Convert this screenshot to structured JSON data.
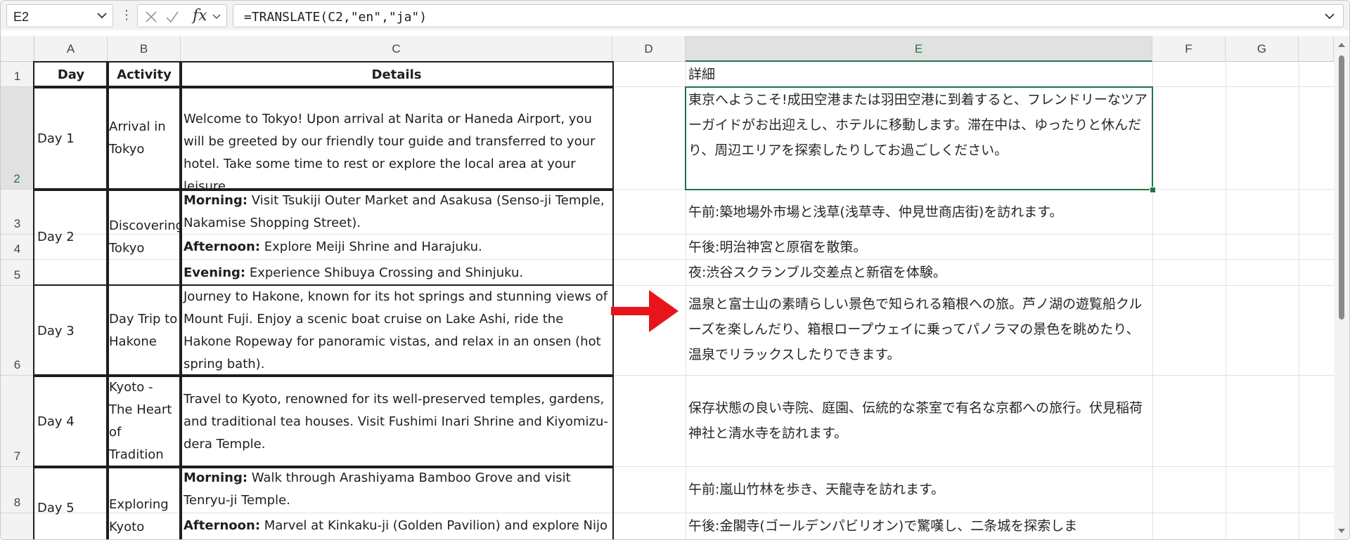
{
  "name_box": {
    "value": "E2"
  },
  "formula_bar": {
    "fx_label": "fx",
    "formula": "=TRANSLATE(C2,\"en\",\"ja\")"
  },
  "columns": [
    "A",
    "B",
    "C",
    "D",
    "E",
    "F",
    "G"
  ],
  "rows": [
    "1",
    "2",
    "3",
    "4",
    "5",
    "6",
    "7",
    "8"
  ],
  "table": {
    "headers": {
      "day": "Day",
      "activity": "Activity",
      "details": "Details"
    },
    "day1": {
      "day": "Day 1",
      "activity": "Arrival in Tokyo",
      "details": "Welcome to Tokyo! Upon arrival at Narita or Haneda Airport, you will be greeted by our friendly tour guide and transferred to your hotel. Take some time to rest or explore the local area at your leisure."
    },
    "day2": {
      "day": "Day 2",
      "activity": "Discovering Tokyo",
      "morning_label": "Morning:",
      "morning": " Visit Tsukiji Outer Market and Asakusa (Senso-ji Temple, Nakamise Shopping Street).",
      "afternoon_label": "Afternoon:",
      "afternoon": " Explore Meiji Shrine and Harajuku.",
      "evening_label": "Evening:",
      "evening": " Experience Shibuya Crossing and Shinjuku."
    },
    "day3": {
      "day": "Day 3",
      "activity": "Day Trip to Hakone",
      "details": "Journey to Hakone, known for its hot springs and stunning views of Mount Fuji. Enjoy a scenic boat cruise on Lake Ashi, ride the Hakone Ropeway for panoramic vistas, and relax in an onsen (hot spring bath)."
    },
    "day4": {
      "day": "Day 4",
      "activity": "Kyoto - The Heart of Tradition",
      "details": "Travel to Kyoto, renowned for its well-preserved temples, gardens, and traditional tea houses. Visit Fushimi Inari Shrine and Kiyomizu-dera Temple."
    },
    "day5": {
      "day": "Day 5",
      "activity": "Exploring Kyoto",
      "morning_label": "Morning:",
      "morning": " Walk through Arashiyama Bamboo Grove and visit Tenryu-ji Temple.",
      "afternoon_label": "Afternoon:",
      "afternoon": " Marvel at Kinkaku-ji (Golden Pavilion) and explore Nijo"
    }
  },
  "translations": {
    "e1": "詳細",
    "e2": "東京へようこそ!成田空港または羽田空港に到着すると、フレンドリーなツアーガイドがお出迎えし、ホテルに移動します。滞在中は、ゆったりと休んだり、周辺エリアを探索したりしてお過ごしください。",
    "e3": "午前:築地場外市場と浅草(浅草寺、仲見世商店街)を訪れます。",
    "e4": "午後:明治神宮と原宿を散策。",
    "e5": "夜:渋谷スクランブル交差点と新宿を体験。",
    "e6": "温泉と富士山の素晴らしい景色で知られる箱根への旅。芦ノ湖の遊覧船クルーズを楽しんだり、箱根ロープウェイに乗ってパノラマの景色を眺めたり、温泉でリラックスしたりできます。",
    "e7": "保存状態の良い寺院、庭園、伝統的な茶室で有名な京都への旅行。伏見稲荷神社と清水寺を訪れます。",
    "e8": "午前:嵐山竹林を歩き、天龍寺を訪れます。",
    "e9": "午後:金閣寺(ゴールデンパビリオン)で驚嘆し、二条城を探索しま"
  },
  "colors": {
    "accent": "#217346",
    "arrow": "#e8141c"
  }
}
